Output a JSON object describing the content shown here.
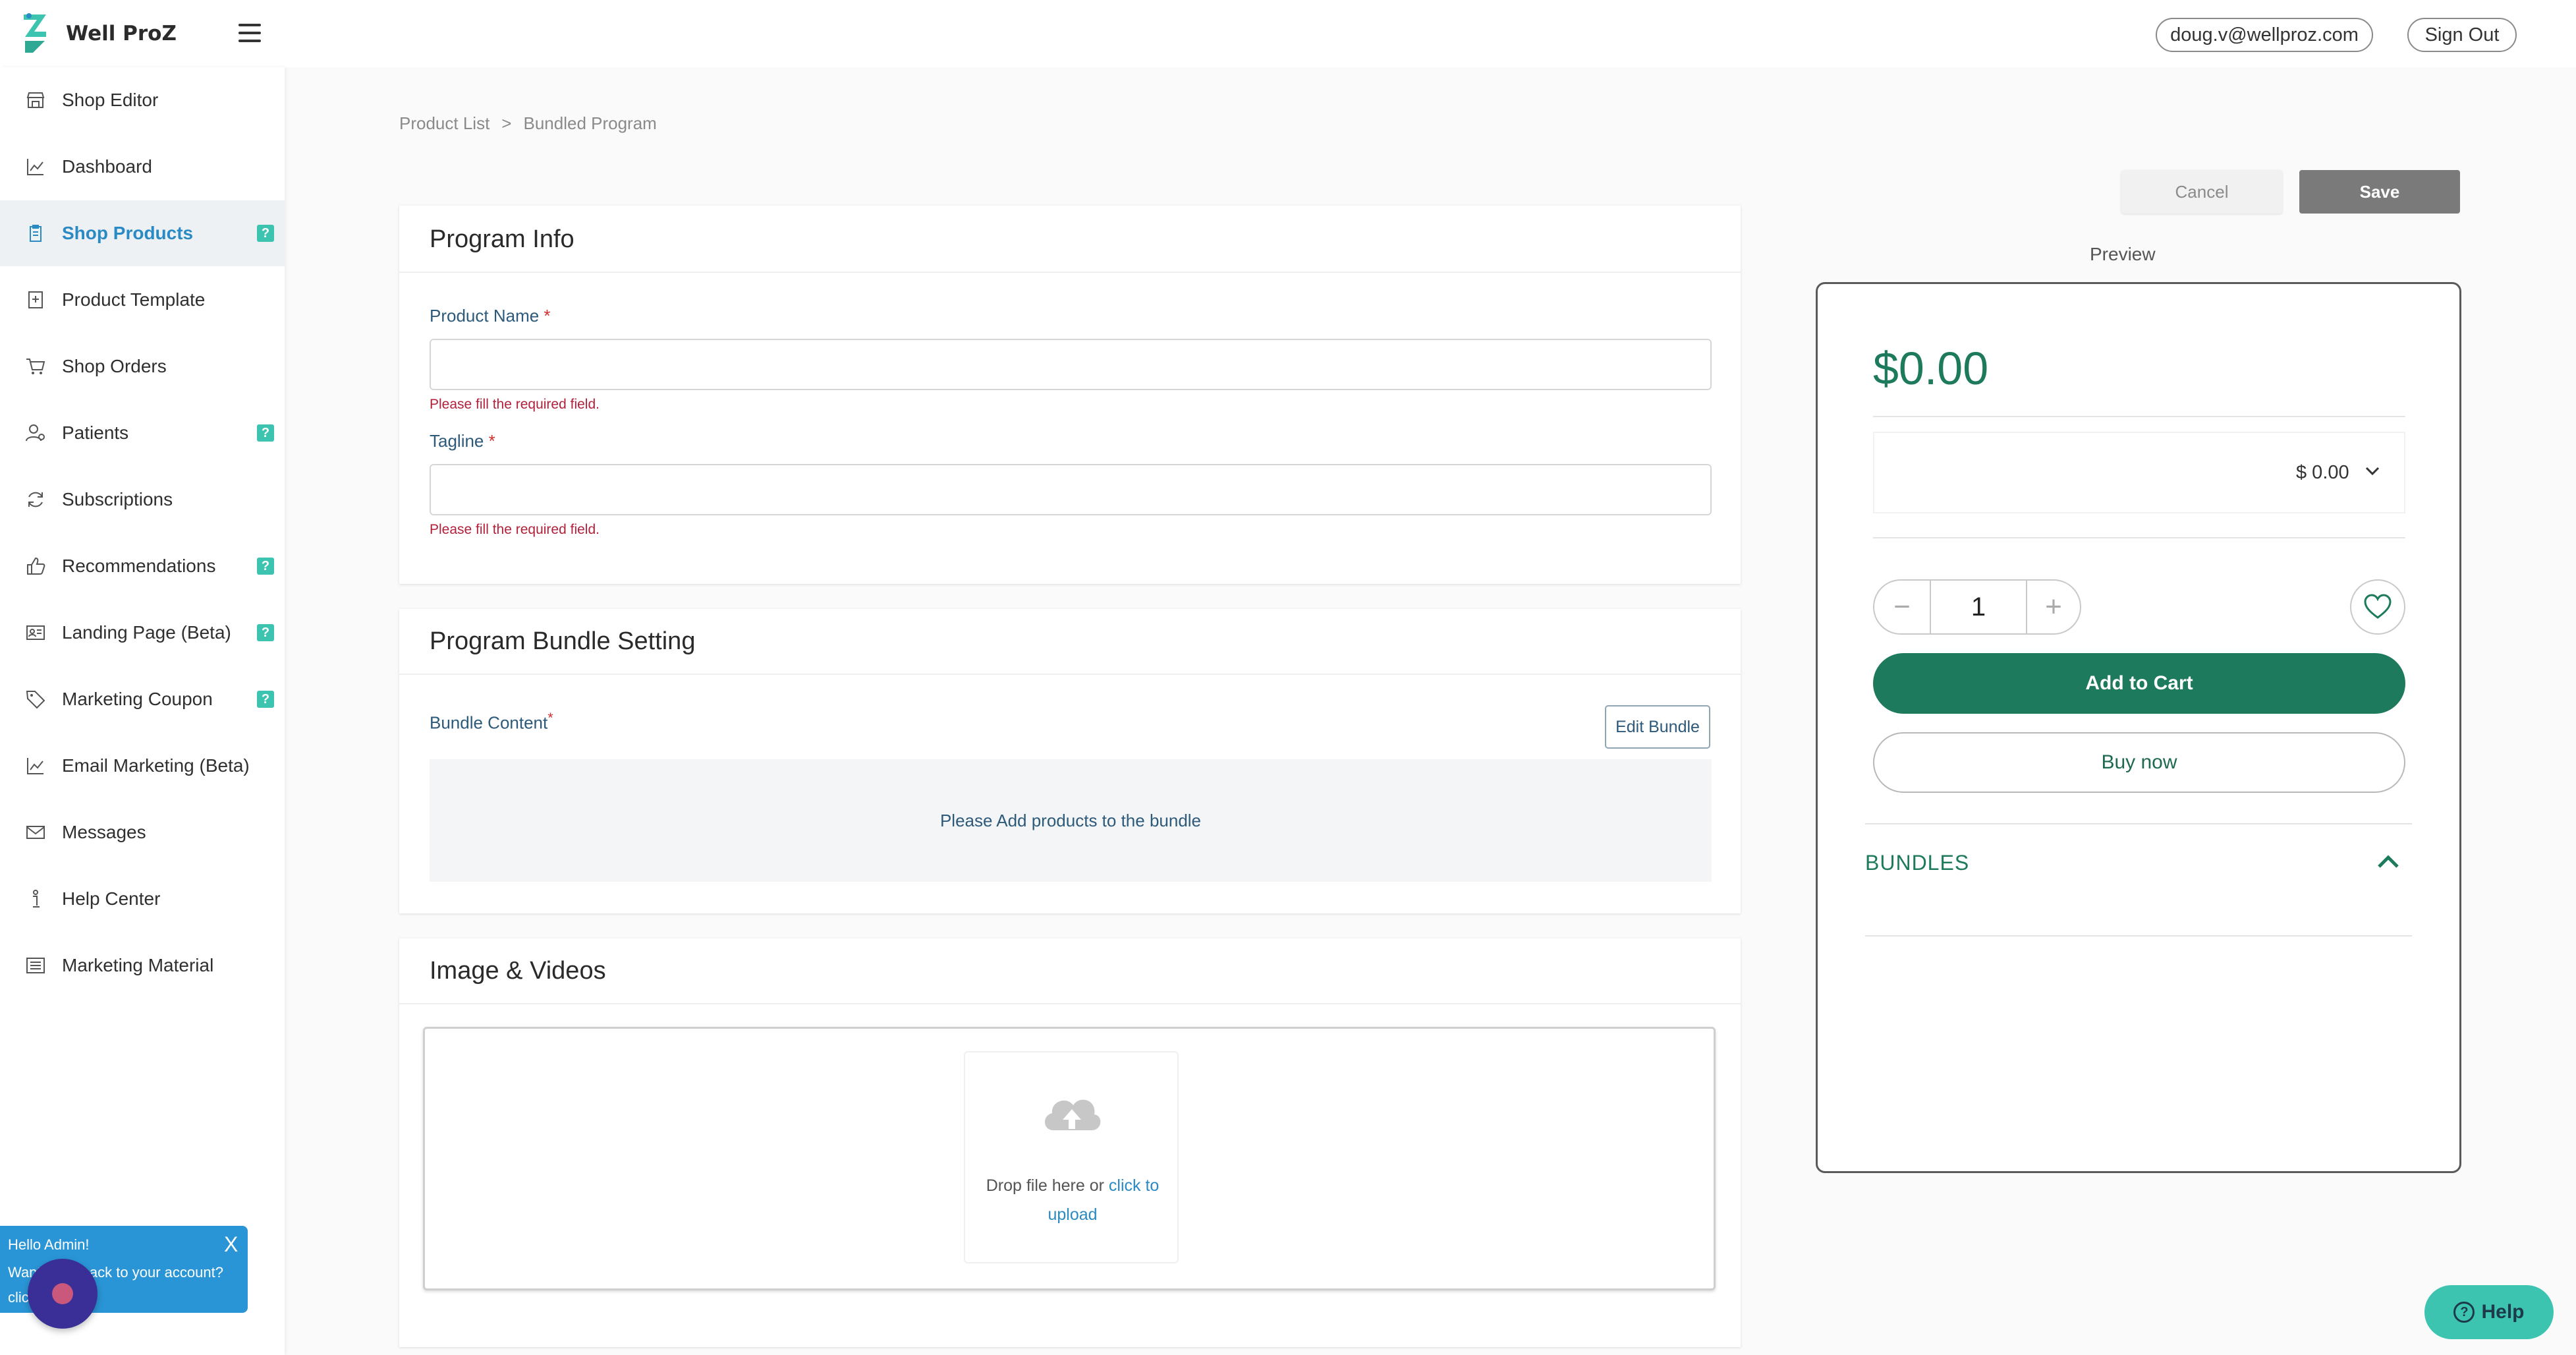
{
  "header": {
    "brand": "Well ProZ",
    "email": "doug.v@wellproz.com",
    "sign_out": "Sign Out"
  },
  "sidebar": {
    "items": [
      {
        "label": "Shop Editor",
        "icon": "storefront-icon",
        "help": false,
        "active": false
      },
      {
        "label": "Dashboard",
        "icon": "chart-line-icon",
        "help": false,
        "active": false
      },
      {
        "label": "Shop Products",
        "icon": "clipboard-icon",
        "help": true,
        "active": true
      },
      {
        "label": "Product Template",
        "icon": "template-add-icon",
        "help": false,
        "active": false
      },
      {
        "label": "Shop Orders",
        "icon": "cart-icon",
        "help": false,
        "active": false
      },
      {
        "label": "Patients",
        "icon": "users-icon",
        "help": true,
        "active": false
      },
      {
        "label": "Subscriptions",
        "icon": "refresh-icon",
        "help": false,
        "active": false
      },
      {
        "label": "Recommendations",
        "icon": "thumbs-up-icon",
        "help": true,
        "active": false
      },
      {
        "label": "Landing Page (Beta)",
        "icon": "id-card-icon",
        "help": true,
        "active": false
      },
      {
        "label": "Marketing Coupon",
        "icon": "tag-icon",
        "help": true,
        "active": false
      },
      {
        "label": "Email Marketing (Beta)",
        "icon": "chart-line-icon",
        "help": false,
        "active": false
      },
      {
        "label": "Messages",
        "icon": "mail-icon",
        "help": false,
        "active": false
      },
      {
        "label": "Help Center",
        "icon": "info-icon",
        "help": false,
        "active": false
      },
      {
        "label": "Marketing Material",
        "icon": "list-icon",
        "help": false,
        "active": false
      }
    ],
    "help_badge": "?"
  },
  "chat_popup": {
    "hello": "Hello Admin!",
    "message": "Want to go back to your account? click here",
    "close": "X"
  },
  "breadcrumb": {
    "parent": "Product List",
    "separator": ">",
    "current": "Bundled Program"
  },
  "program_info": {
    "title": "Program Info",
    "product_name_label": "Product Name",
    "tagline_label": "Tagline",
    "required_mark": "*",
    "error": "Please fill the required field.",
    "product_name_value": "",
    "tagline_value": ""
  },
  "bundle_setting": {
    "title": "Program Bundle Setting",
    "content_label": "Bundle Content",
    "required_mark": "*",
    "edit_button": "Edit Bundle",
    "empty_message": "Please Add products to the bundle"
  },
  "media": {
    "title": "Image & Videos",
    "drop_text": "Drop file here or",
    "upload_link": "click to upload"
  },
  "actions": {
    "cancel": "Cancel",
    "save": "Save"
  },
  "preview": {
    "label": "Preview",
    "price": "$0.00",
    "option_price": "$ 0.00",
    "quantity": "1",
    "minus": "−",
    "plus": "+",
    "add_to_cart": "Add to Cart",
    "buy_now": "Buy now",
    "bundles": "BUNDLES"
  },
  "help_button": {
    "label": "Help",
    "icon": "?"
  },
  "colors": {
    "accent_green": "#1e7a5c",
    "link_blue": "#2a8ac4",
    "teal_badge": "#3cc4b0",
    "error_red": "#b2203a"
  }
}
